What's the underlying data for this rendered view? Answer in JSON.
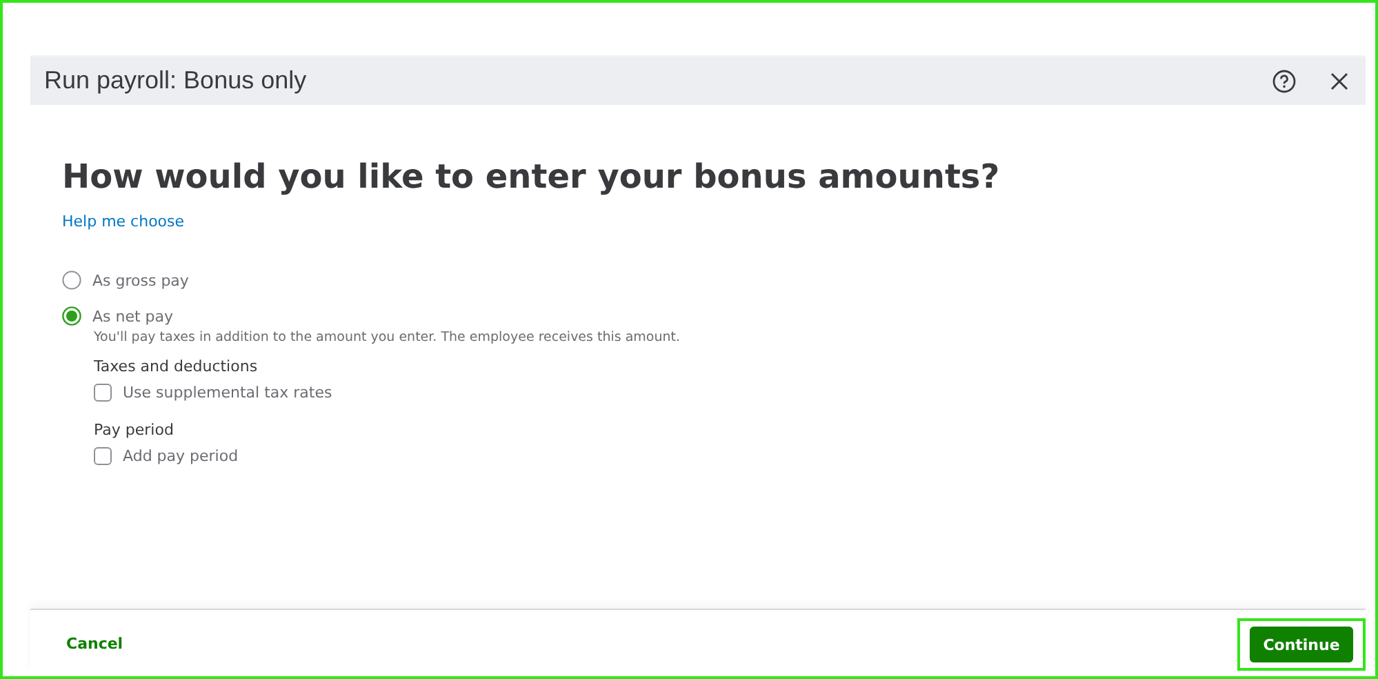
{
  "window": {
    "title": "Run payroll: Bonus only"
  },
  "heading": "How would you like to enter your bonus amounts?",
  "help_link": "Help me choose",
  "options": [
    {
      "label": "As gross pay",
      "selected": false
    },
    {
      "label": "As net pay",
      "selected": true,
      "description": "You'll pay taxes in addition to the amount you enter. The employee receives this amount."
    }
  ],
  "sections": [
    {
      "title": "Taxes and deductions",
      "checkbox": {
        "label": "Use supplemental tax rates",
        "checked": false
      }
    },
    {
      "title": "Pay period",
      "checkbox": {
        "label": "Add pay period",
        "checked": false
      }
    }
  ],
  "footer": {
    "cancel": "Cancel",
    "continue": "Continue"
  }
}
